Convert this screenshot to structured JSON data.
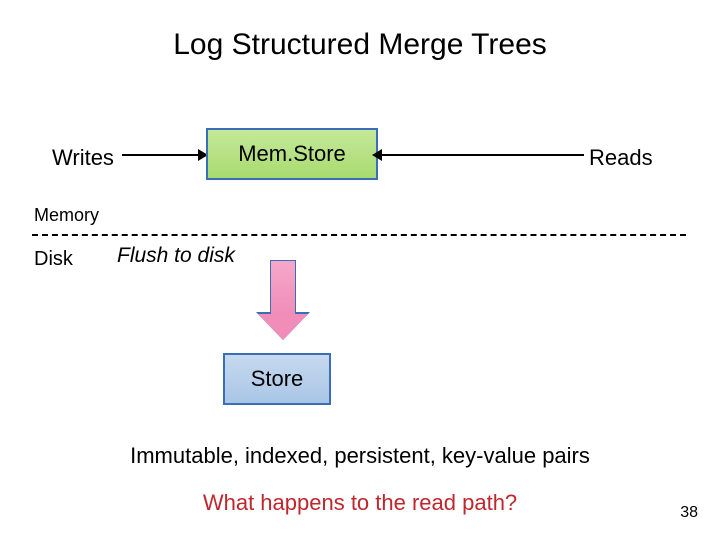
{
  "title": "Log Structured Merge Trees",
  "labels": {
    "writes": "Writes",
    "reads": "Reads",
    "memory": "Memory",
    "disk": "Disk",
    "flush": "Flush to disk"
  },
  "boxes": {
    "memstore": "Mem.Store",
    "store": "Store"
  },
  "footer": {
    "immutable": "Immutable, indexed, persistent, key-value pairs",
    "question": "What happens to the read path?"
  },
  "page_number": "38"
}
